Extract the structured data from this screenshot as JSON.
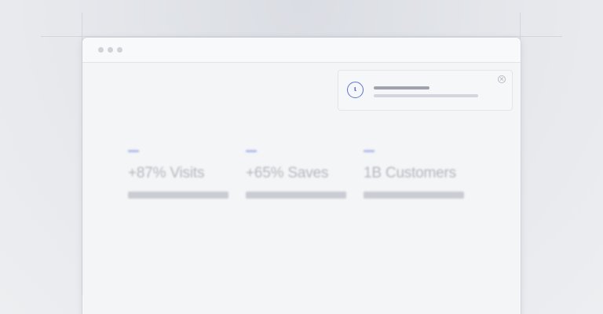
{
  "window": {
    "controls": [
      "dot",
      "dot",
      "dot"
    ]
  },
  "notification": {
    "icon_glyph": "ι",
    "icon_name": "timer-icon",
    "close_glyph": "×",
    "accent_color": "#5f74d4"
  },
  "stats": [
    {
      "value": "+87% Visits"
    },
    {
      "value": "+65% Saves"
    },
    {
      "value": "1B Customers"
    }
  ],
  "colors": {
    "accent": "#5f74d4",
    "stat_accent": "#b2bcec"
  }
}
